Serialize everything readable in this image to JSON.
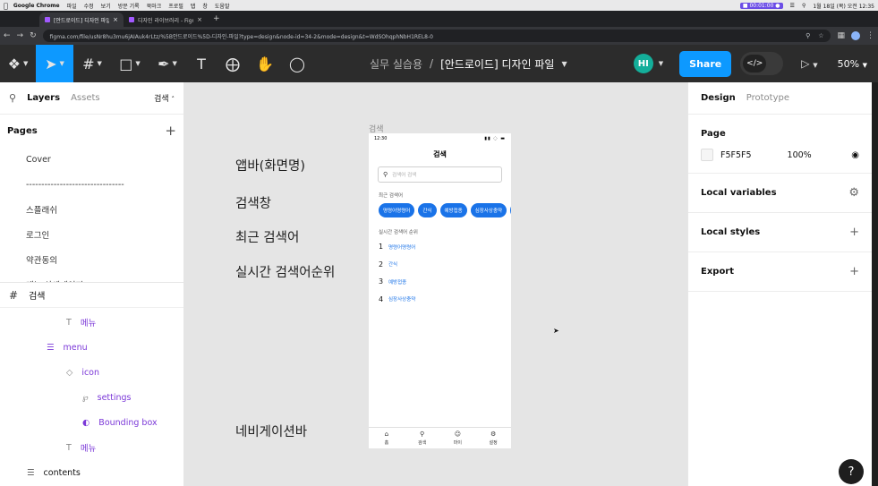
{
  "os_menubar": {
    "app": "Google Chrome",
    "menus": [
      "파일",
      "수정",
      "보기",
      "방문 기록",
      "북마크",
      "프로필",
      "탭",
      "창",
      "도움말"
    ],
    "recording": "00:01:00",
    "clock": "1월 18일 (목) 오전 12:35"
  },
  "browser": {
    "tabs": [
      {
        "title": "[안드로이드] 디자인 파일 - Figma",
        "active": true
      },
      {
        "title": "디자인 라이브러리 - Figma",
        "active": false
      }
    ],
    "url": "figma.com/file/usNr8hu3mu6jAIAuk4rLtz/%5B안드로이드%5D-디자인-파일?type=design&node-id=34-2&mode=design&t=WdSOhqphNbH1REL8-0"
  },
  "figma": {
    "tools": [
      "main-menu",
      "move",
      "frame",
      "shape",
      "pen",
      "text",
      "resources",
      "hand",
      "comment"
    ],
    "breadcrumb": {
      "team": "실무 실습용",
      "separator": "/",
      "file": "[안드로이드] 디자인 파일"
    },
    "avatar": "HI",
    "share_label": "Share",
    "dev_mode_icon": "</>",
    "zoom": "50%"
  },
  "left_panel": {
    "tab_layers": "Layers",
    "tab_assets": "Assets",
    "current_page": "검색",
    "pages_title": "Pages",
    "pages": [
      "Cover",
      "--------------------------------",
      "스플래쉬",
      "로그인",
      "약관동의",
      "메뉴 상세페이지"
    ],
    "frame_name": "검색",
    "layers": [
      {
        "name": "메뉴",
        "icon": "text-icon",
        "indent": 74,
        "purple": true
      },
      {
        "name": "menu",
        "icon": "component-icon",
        "indent": 52,
        "purple": true
      },
      {
        "name": "icon",
        "icon": "diamond-icon",
        "indent": 74,
        "purple": true
      },
      {
        "name": "settings",
        "icon": "vector-icon",
        "indent": 92,
        "purple": true
      },
      {
        "name": "Bounding box",
        "icon": "ellipse-icon",
        "indent": 92,
        "purple": true
      },
      {
        "name": "메뉴",
        "icon": "text-icon",
        "indent": 74,
        "purple": true
      },
      {
        "name": "contents",
        "icon": "list-icon",
        "indent": 30,
        "purple": false
      }
    ]
  },
  "canvas": {
    "annotations": [
      "앱바(화면명)",
      "검색창",
      "최근 검색어",
      "실시간 검색어순위",
      "네비게이션바"
    ],
    "frame_label": "검색",
    "phone": {
      "time": "12:30",
      "title": "검색",
      "search_placeholder": "검색어 검색",
      "recent_label": "최근 검색어",
      "recent_chips": [
        "명령어명령어",
        "간식",
        "예방접종",
        "심장사상충약",
        "노"
      ],
      "realtime_label": "실시간 검색어 순위",
      "ranking": [
        {
          "rank": "1",
          "term": "명령어명령어"
        },
        {
          "rank": "2",
          "term": "간식"
        },
        {
          "rank": "3",
          "term": "예방접종"
        },
        {
          "rank": "4",
          "term": "심장사상충약"
        }
      ],
      "nav": [
        {
          "label": "홈",
          "icon": "home-icon"
        },
        {
          "label": "검색",
          "icon": "search-icon"
        },
        {
          "label": "마이",
          "icon": "face-icon"
        },
        {
          "label": "설정",
          "icon": "settings-icon"
        }
      ]
    }
  },
  "right_panel": {
    "tab_design": "Design",
    "tab_prototype": "Prototype",
    "page_title": "Page",
    "page_color": "F5F5F5",
    "page_opacity": "100%",
    "local_variables": "Local variables",
    "local_styles": "Local styles",
    "export": "Export"
  },
  "help": "?"
}
